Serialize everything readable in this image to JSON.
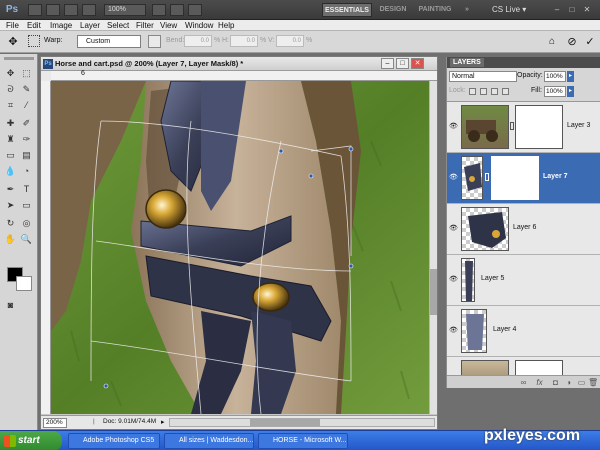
{
  "app": {
    "logo": "Ps",
    "zoom": "100%",
    "workspaces": [
      "ESSENTIALS",
      "DESIGN",
      "PAINTING",
      "»"
    ],
    "cs_live": "CS Live ▾",
    "window_controls": [
      "–",
      "□",
      "✕"
    ]
  },
  "menu": [
    "File",
    "Edit",
    "Image",
    "Layer",
    "Select",
    "Filter",
    "View",
    "Window",
    "Help"
  ],
  "options": {
    "warp_label": "Warp:",
    "warp_value": "Custom",
    "bend_label": "Bend:",
    "bend_value": "0.0",
    "bend_unit": "%",
    "h_label": "H:",
    "h_value": "0.0",
    "h_unit": "%",
    "v_label": "V:",
    "v_value": "0.0",
    "v_unit": "%"
  },
  "document": {
    "icon": "Ps",
    "title": "Horse and cart.psd @ 200% (Layer 7, Layer Mask/8) *",
    "controls": [
      "–",
      "□",
      "✕"
    ],
    "ruler_mark": "6",
    "zoom": "200%",
    "doc_size": "Doc: 9.01M/74.4M",
    "status_arrow": "▸"
  },
  "layers_panel": {
    "tab": "LAYERS",
    "blend_mode": "Normal",
    "opacity_label": "Opacity:",
    "opacity": "100%",
    "lock_label": "Lock:",
    "fill_label": "Fill:",
    "fill": "100%",
    "layers": [
      {
        "name": "Layer 3",
        "selected": false
      },
      {
        "name": "Layer 7",
        "selected": true
      },
      {
        "name": "Layer 6",
        "selected": false
      },
      {
        "name": "Layer 5",
        "selected": false
      },
      {
        "name": "Layer 4",
        "selected": false
      }
    ],
    "footer_icons": [
      "link-icon",
      "fx-icon",
      "mask-icon",
      "adjustment-icon",
      "folder-icon",
      "new-layer-icon",
      "trash-icon"
    ]
  },
  "taskbar": {
    "start": "start",
    "tasks": [
      "Adobe Photoshop CS5",
      "All sizes | Waddesdon...",
      "HORSE - Microsoft W..."
    ]
  },
  "watermark": "pxleyes.com",
  "colors": {
    "selection": "#3b6bb3",
    "taskbar": "#2f67d8",
    "start": "#3a9a37",
    "grass": "#5f8d2e",
    "strap": "#2f3348",
    "strap_highlight": "#6d7596"
  }
}
